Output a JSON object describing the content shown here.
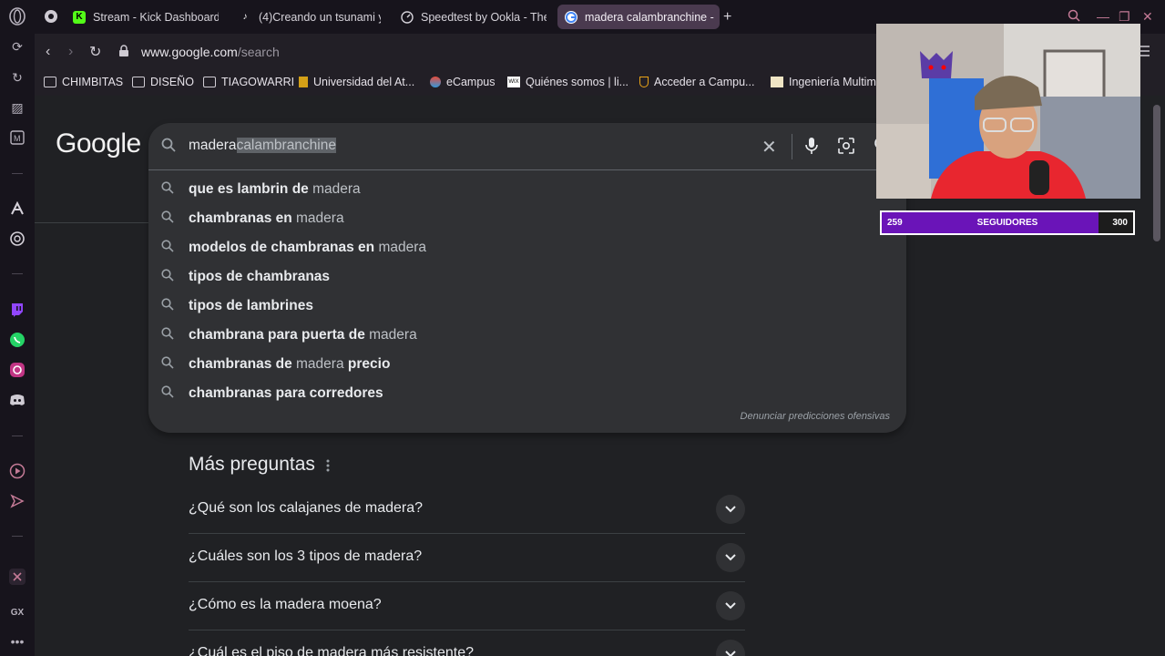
{
  "tabs": [
    {
      "label": "Stream - Kick Dashboard",
      "icon": "kick-icon"
    },
    {
      "label": "(4)Creando un tsunami y",
      "icon": "tiktok-icon"
    },
    {
      "label": "Speedtest by Ookla - The",
      "icon": "speedtest-icon"
    },
    {
      "label": "madera calambranchine -",
      "icon": "google-icon",
      "active": true
    }
  ],
  "address": {
    "domain": "www.google.com",
    "path": "/search"
  },
  "bookmarks": [
    {
      "label": "CHIMBITAS",
      "icon": "folder-icon"
    },
    {
      "label": "DISEÑO",
      "icon": "folder-icon"
    },
    {
      "label": "TIAGOWARRI",
      "icon": "folder-icon"
    },
    {
      "label": "Universidad del At...",
      "icon": "university-icon"
    },
    {
      "label": "eCampus",
      "icon": "ecampus-icon"
    },
    {
      "label": "Quiénes somos | li...",
      "icon": "wix-icon"
    },
    {
      "label": "Acceder a Campu...",
      "icon": "campus-icon"
    },
    {
      "label": "Ingeniería Multime",
      "icon": "page-icon"
    }
  ],
  "google": {
    "logo": "Google",
    "query_typed": "madera",
    "query_autocomplete": "calambranchine",
    "suggestions": [
      {
        "bold_pre": "que es lambrin de",
        "normal": " madera",
        "bold_post": ""
      },
      {
        "bold_pre": "chambranas en",
        "normal": " madera",
        "bold_post": ""
      },
      {
        "bold_pre": "modelos de chambranas en",
        "normal": " madera",
        "bold_post": ""
      },
      {
        "bold_pre": "tipos de chambranas",
        "normal": "",
        "bold_post": ""
      },
      {
        "bold_pre": "tipos de lambrines",
        "normal": "",
        "bold_post": ""
      },
      {
        "bold_pre": "chambrana para puerta de",
        "normal": " madera",
        "bold_post": ""
      },
      {
        "bold_pre": "chambranas de",
        "normal": " madera",
        "bold_post": " precio"
      },
      {
        "bold_pre": "chambranas para corredores",
        "normal": "",
        "bold_post": ""
      }
    ],
    "report_link": "Denunciar predicciones ofensivas",
    "more_title": "Más preguntas",
    "questions": [
      "¿Qué son los calajanes de madera?",
      "¿Cuáles son los 3 tipos de madera?",
      "¿Cómo es la madera moena?",
      "¿Cuál es el piso de madera más resistente?"
    ]
  },
  "followers": {
    "current": "259",
    "label": "SEGUIDORES",
    "goal": "300",
    "progress": 0.863
  },
  "colors": {
    "accent_purple": "#6a14b8",
    "google_bg": "#202124",
    "opera_bg": "#17141c"
  }
}
